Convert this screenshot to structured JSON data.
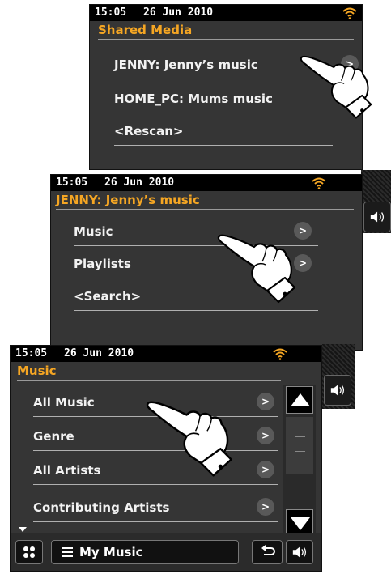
{
  "screen1": {
    "time": "15:05",
    "date": "26 Jun 2010",
    "title": "Shared Media",
    "items": [
      {
        "label": "JENNY: Jenny’s music"
      },
      {
        "label": "HOME_PC: Mums music"
      },
      {
        "label": "<Rescan>"
      }
    ]
  },
  "screen2": {
    "time": "15:05",
    "date": "26 Jun 2010",
    "title": "JENNY: Jenny’s music",
    "items": [
      {
        "label": "Music"
      },
      {
        "label": "Playlists"
      },
      {
        "label": "<Search>"
      }
    ]
  },
  "screen3": {
    "time": "15:05",
    "date": "26 Jun 2010",
    "title": "Music",
    "items": [
      {
        "label": "All Music"
      },
      {
        "label": "Genre"
      },
      {
        "label": "All Artists"
      },
      {
        "label": "Contributing Artists"
      }
    ],
    "bottom_label": "My Music"
  },
  "icons": {
    "wifi": "wifi-icon",
    "arrow": "chevron-right-icon",
    "volume": "volume-icon",
    "back": "back-icon",
    "menu": "grid-menu-icon",
    "list": "list-icon",
    "scroll_up": "triangle-up-icon",
    "scroll_down": "triangle-down-icon",
    "pointer": "pointing-hand-icon"
  },
  "colors": {
    "accent": "#f5a623",
    "screen_bg": "#353535",
    "status_bar": "#000000"
  }
}
